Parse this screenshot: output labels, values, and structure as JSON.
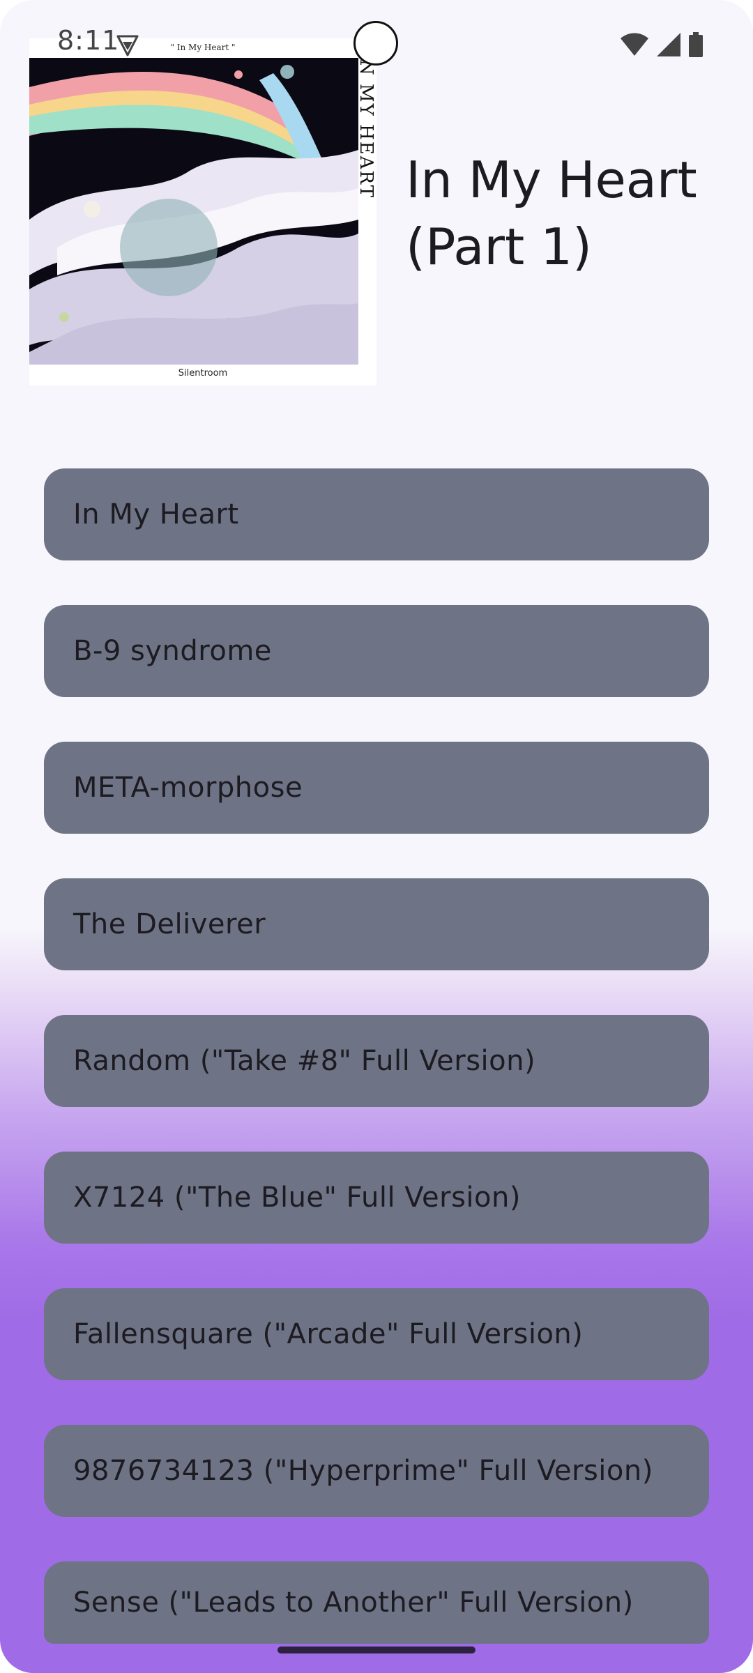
{
  "status_bar": {
    "time": "8:11"
  },
  "album": {
    "title": "In My Heart (Part 1)",
    "art_top_text": "\" In My Heart \"",
    "art_vertical_text": "IN MY HEART",
    "art_label": "Silentroom"
  },
  "tracks": [
    {
      "title": "In My Heart"
    },
    {
      "title": "B-9 syndrome"
    },
    {
      "title": "META-morphose"
    },
    {
      "title": "The Deliverer"
    },
    {
      "title": "Random (\"Take #8\" Full Version)"
    },
    {
      "title": "X7124 (\"The Blue\" Full Version)"
    },
    {
      "title": "Fallensquare (\"Arcade\" Full Version)"
    },
    {
      "title": "9876734123 (\"Hyperprime\" Full Version)"
    },
    {
      "title": "Sense (\"Leads to Another\" Full Version)"
    }
  ],
  "colors": {
    "track_button": "#6e7385",
    "background_top": "#f7f6fc",
    "background_bottom": "#9f6be6"
  },
  "icons": {
    "status_shield": "shield-icon",
    "wifi": "wifi-icon",
    "signal": "signal-icon",
    "battery": "battery-icon"
  }
}
